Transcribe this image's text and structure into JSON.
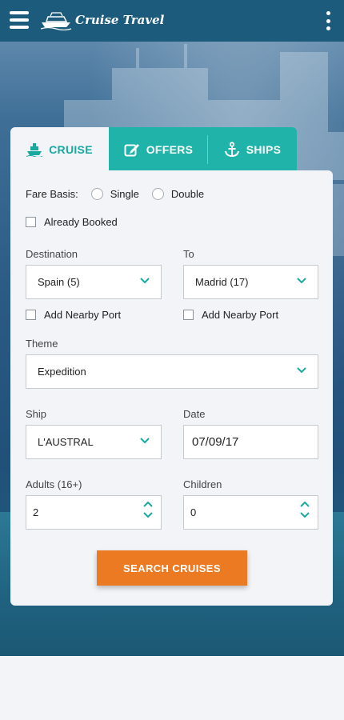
{
  "header": {
    "brand": "Cruise Travel",
    "menu_icon": "hamburger-menu-icon",
    "more_icon": "vertical-dots-icon"
  },
  "tabs": [
    {
      "label": "CRUISE",
      "icon": "ship-icon",
      "active": true
    },
    {
      "label": "OFFERS",
      "icon": "edit-icon",
      "active": false
    },
    {
      "label": "SHIPS",
      "icon": "anchor-icon",
      "active": false
    }
  ],
  "form": {
    "fare_basis": {
      "label": "Fare Basis:",
      "options": [
        "Single",
        "Double"
      ],
      "selected": null
    },
    "already_booked": {
      "label": "Already Booked",
      "checked": false
    },
    "destination": {
      "label": "Destination",
      "value": "Spain (5)",
      "nearby_label": "Add Nearby Port",
      "nearby_checked": false
    },
    "to": {
      "label": "To",
      "value": "Madrid (17)",
      "nearby_label": "Add Nearby Port",
      "nearby_checked": false
    },
    "theme": {
      "label": "Theme",
      "value": "Expedition"
    },
    "ship": {
      "label": "Ship",
      "value": "L'AUSTRAL"
    },
    "date": {
      "label": "Date",
      "value": "07/09/17"
    },
    "adults": {
      "label": "Adults (16+)",
      "value": "2"
    },
    "children": {
      "label": "Children",
      "value": "0"
    },
    "submit_label": "SEARCH CRUISES"
  },
  "colors": {
    "header_bg": "#1c5b7c",
    "tab_teal": "#1fb3a9",
    "accent_teal": "#17a9a0",
    "button_orange": "#ec7a22",
    "panel_bg": "#f3f4f8"
  }
}
